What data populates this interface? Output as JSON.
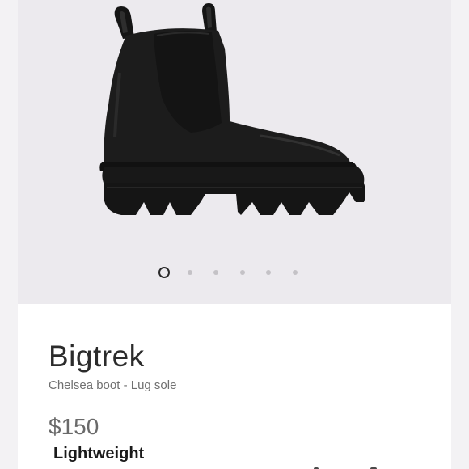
{
  "gallery": {
    "image_alt": "Black Chelsea boot with lug sole",
    "dots_count": 6,
    "active_index": 0
  },
  "product": {
    "name": "Bigtrek",
    "subtitle": "Chelsea boot - Lug sole",
    "price": "$150",
    "feature": "Lightweight"
  },
  "colors": {
    "background": "#f1f0f2",
    "card": "#ffffff",
    "boot": "#1e1e1e",
    "text_primary": "#2b2b2b",
    "text_secondary": "#707070"
  }
}
